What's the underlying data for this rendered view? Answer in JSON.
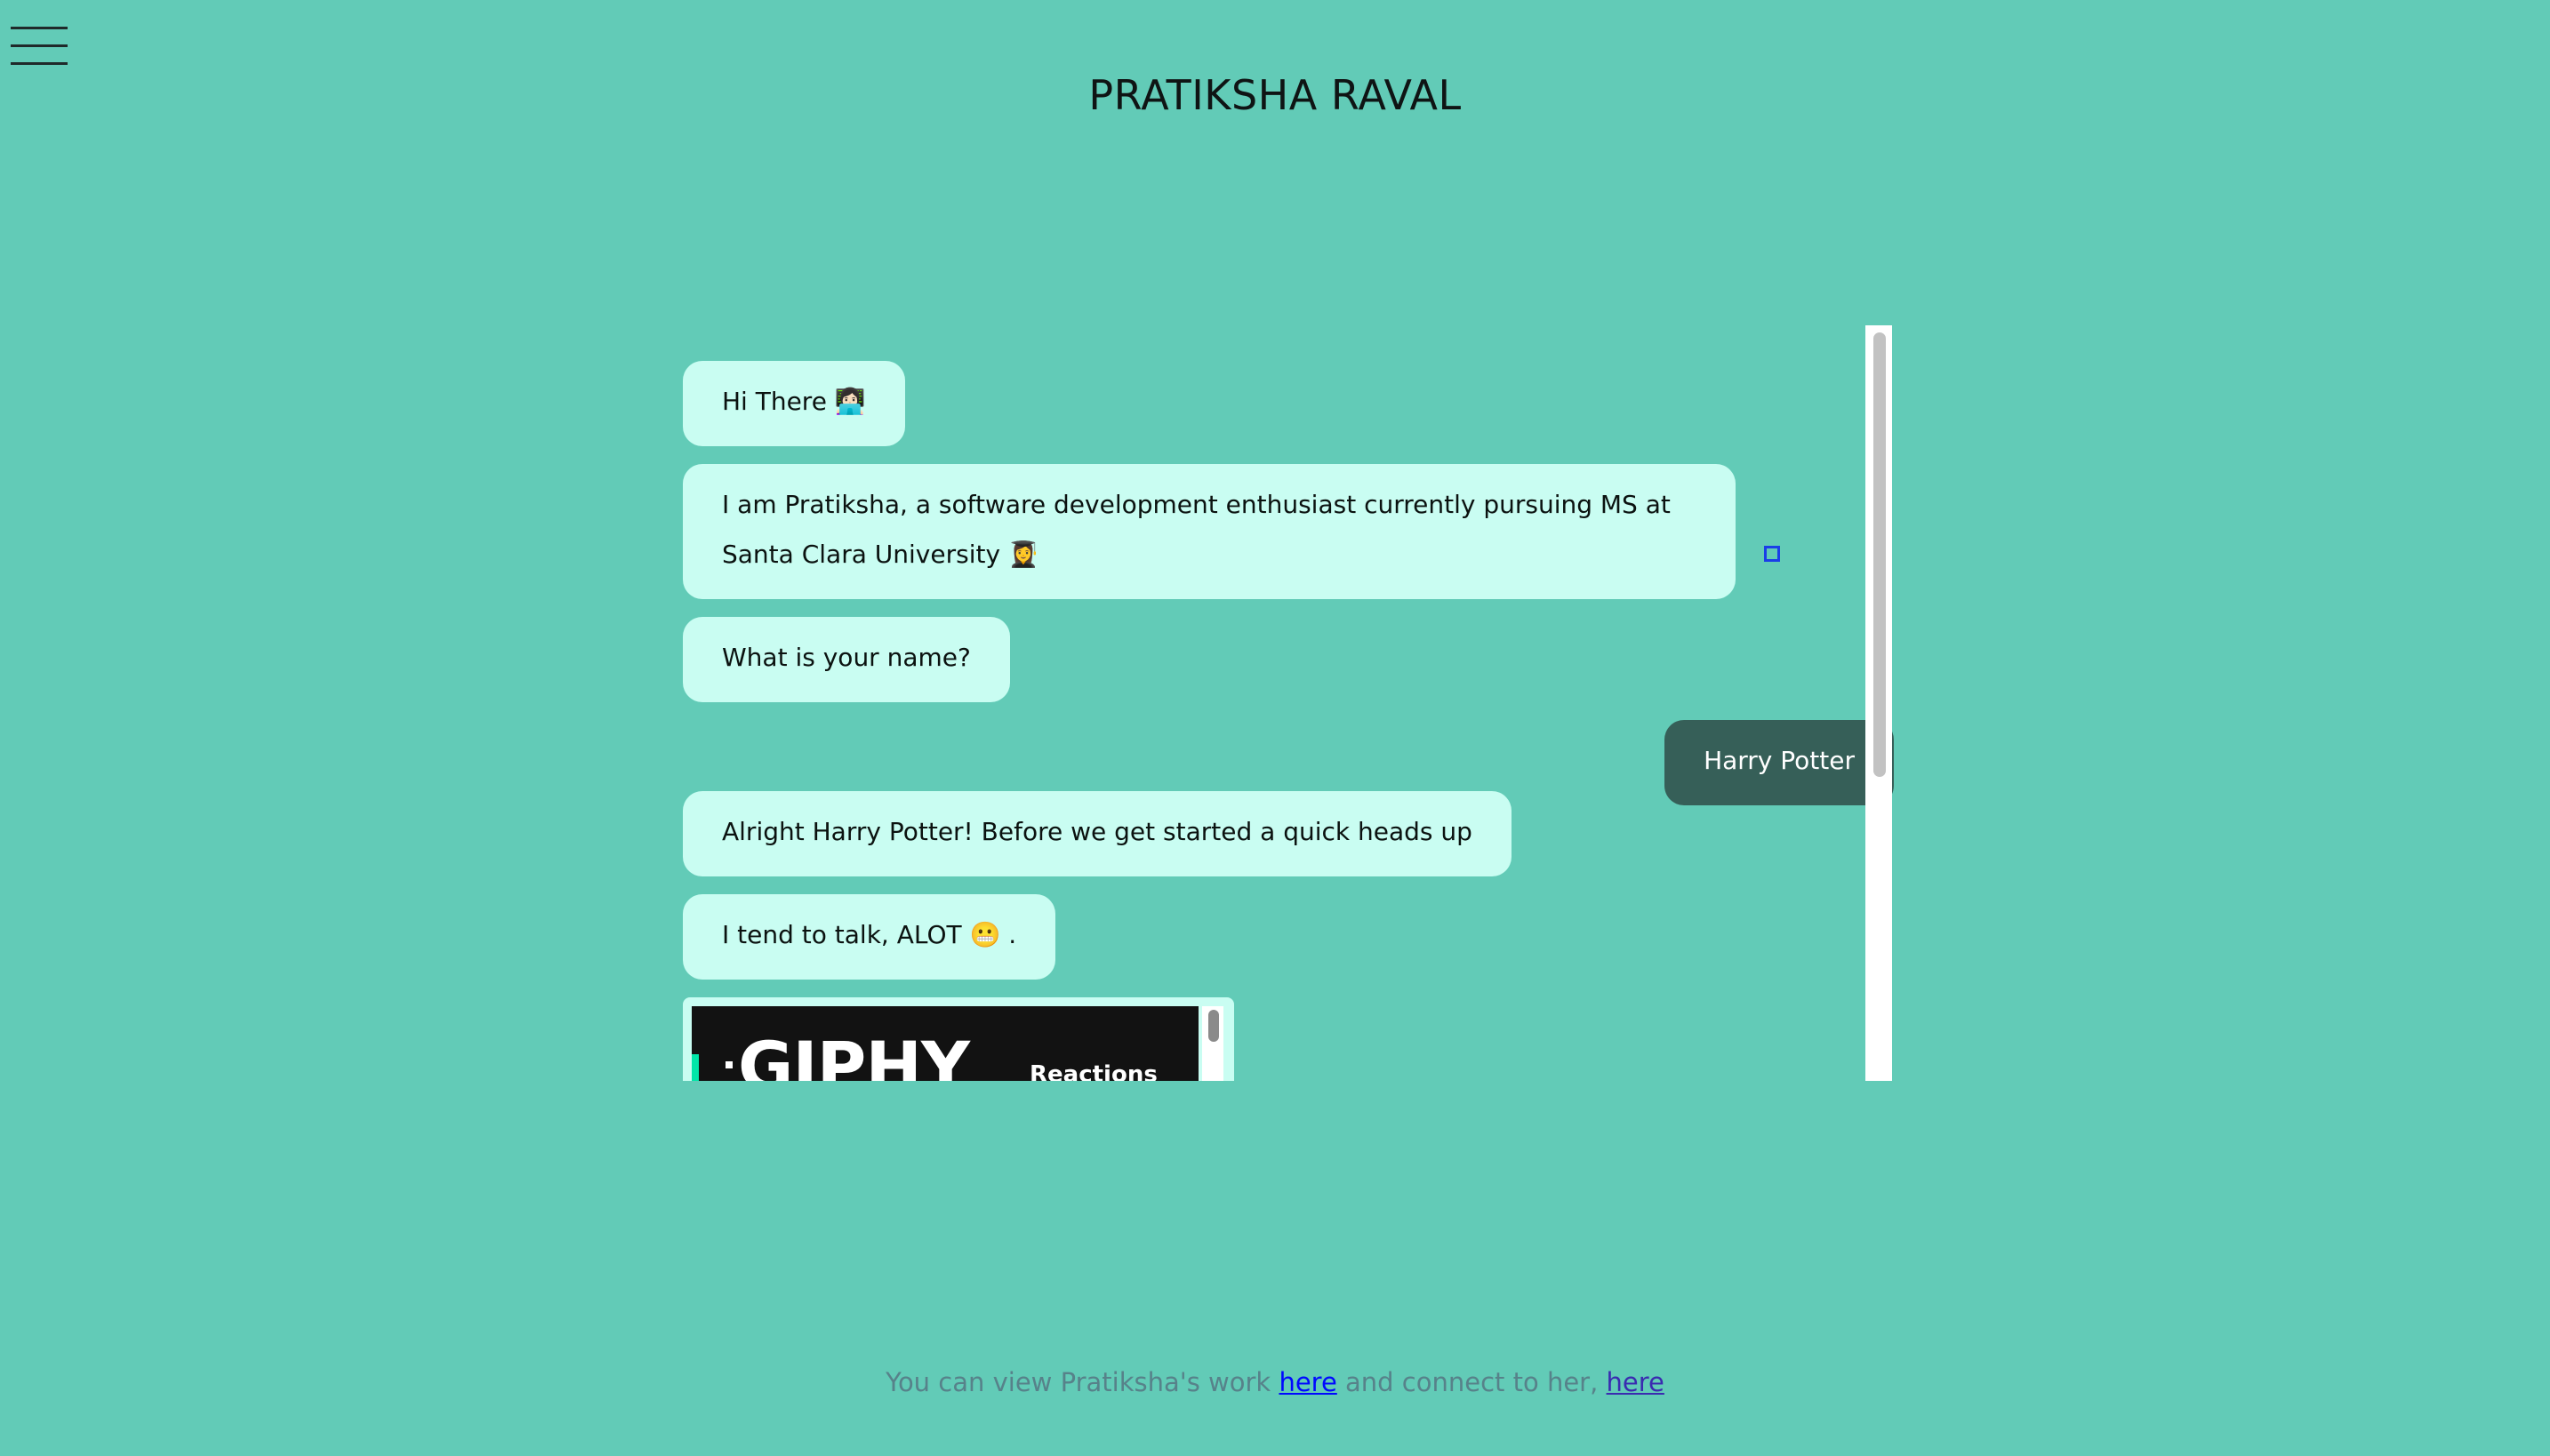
{
  "header": {
    "menu_icon": "hamburger-menu-icon",
    "title": "PRATIKSHA RAVAL"
  },
  "chat": {
    "messages": [
      {
        "sender": "bot",
        "text": "Hi There 👩🏻‍💻"
      },
      {
        "sender": "bot",
        "text": "I am Pratiksha, a software development enthusiast currently pursuing MS at Santa Clara University 👩‍🎓"
      },
      {
        "sender": "bot",
        "text": "What is your name?"
      },
      {
        "sender": "user",
        "text": "Harry Potter"
      },
      {
        "sender": "bot",
        "text": "Alright Harry Potter! Before we get started a quick heads up"
      },
      {
        "sender": "bot",
        "text": "I tend to talk, ALOT 😬 ."
      }
    ],
    "gif": {
      "logo": "GIPHY",
      "nav_label": "Reactions"
    }
  },
  "footer": {
    "text_before": "You can view Pratiksha's work ",
    "link1": "here",
    "text_middle": " and connect to her, ",
    "link2": "here"
  },
  "colors": {
    "background": "#62cbb7",
    "bot_bubble": "#c9fdf2",
    "user_bubble": "#365f58",
    "link": "#0008ff"
  }
}
